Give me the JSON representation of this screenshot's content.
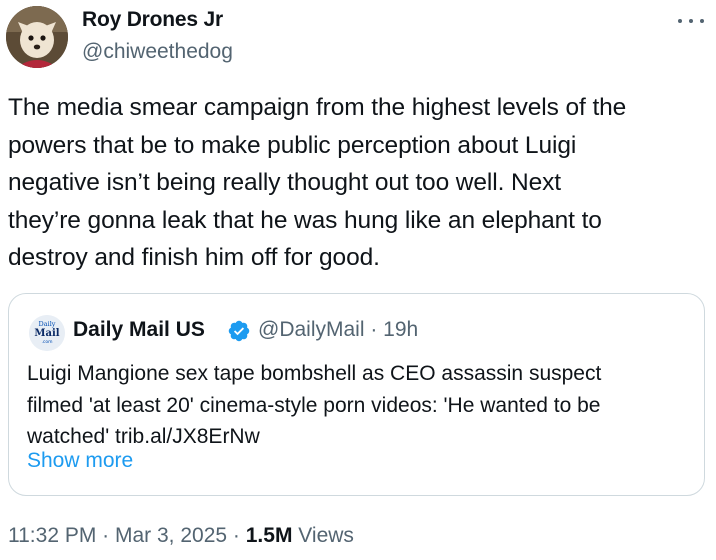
{
  "tweet": {
    "author": {
      "name": "Roy Drones Jr",
      "handle": "@chiweethedog"
    },
    "more_icon": "ellipsis-icon",
    "text": "The media smear campaign from the highest levels of the\npowers that be to make public perception about Luigi\nnegative isn’t being really thought out too well. Next\nthey’re gonna leak that he was hung like an elephant to\ndestroy and finish him off for good.",
    "time": "11:32 PM",
    "sep1": " · ",
    "date": "Mar 3, 2025",
    "sep2": " · ",
    "views_count": "1.5M",
    "views_label": " Views"
  },
  "quote": {
    "logo_text": [
      "Daily",
      "Mail",
      ".com"
    ],
    "name": "Daily Mail US",
    "verified_icon": "verified-badge-icon",
    "handle_time": "@DailyMail · 19h",
    "text": "Luigi Mangione sex tape bombshell as CEO assassin suspect\nfilmed 'at least 20' cinema-style porn videos: 'He wanted to be\nwatched' trib.al/JX8ErNw",
    "show_more": "Show more"
  },
  "colors": {
    "text": "#0f1419",
    "secondary": "#536471",
    "link": "#1d9bf0",
    "border": "#cfd9de",
    "verified": "#1d9bf0"
  }
}
